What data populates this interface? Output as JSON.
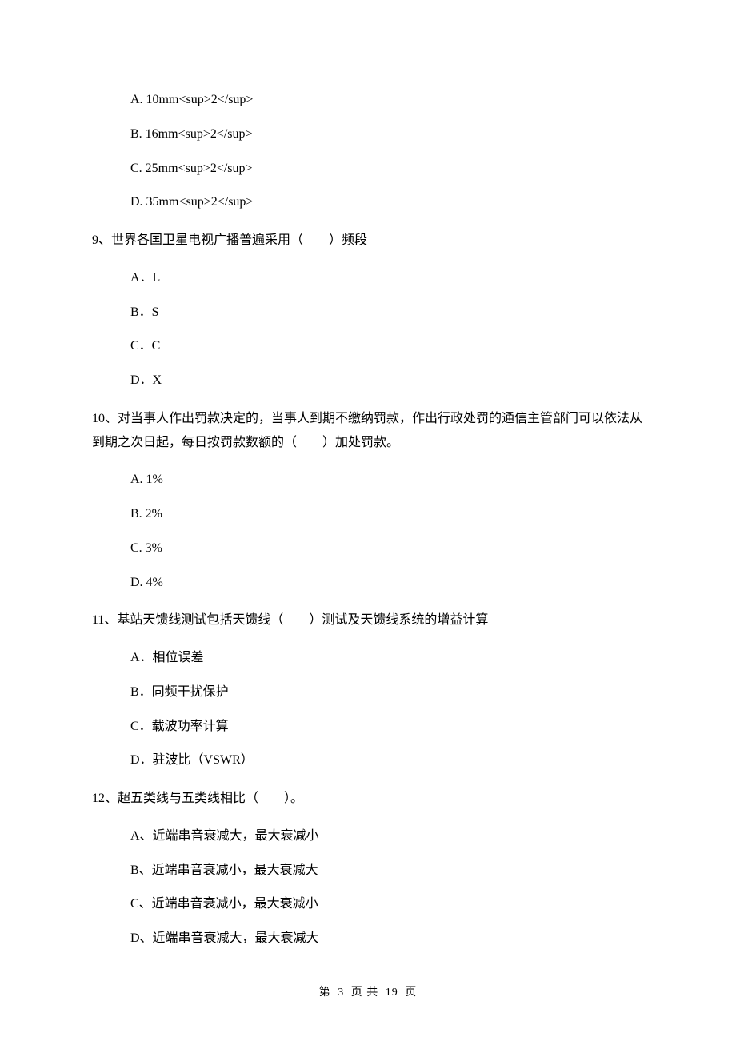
{
  "options_a": "A. 10mm<sup>2</sup>",
  "options_b": "B. 16mm<sup>2</sup>",
  "options_c": "C. 25mm<sup>2</sup>",
  "options_d": "D. 35mm<sup>2</sup>",
  "q9": "9、世界各国卫星电视广播普遍采用（　　）频段",
  "q9_a": "A．L",
  "q9_b": "B．S",
  "q9_c": "C．C",
  "q9_d": "D．X",
  "q10": "10、对当事人作出罚款决定的，当事人到期不缴纳罚款，作出行政处罚的通信主管部门可以依法从到期之次日起，每日按罚款数额的（　　）加处罚款。",
  "q10_a": "A. 1%",
  "q10_b": "B. 2%",
  "q10_c": "C. 3%",
  "q10_d": "D. 4%",
  "q11": "11、基站天馈线测试包括天馈线（　　）测试及天馈线系统的增益计算",
  "q11_a": "A．相位误差",
  "q11_b": "B．同频干扰保护",
  "q11_c": "C．载波功率计算",
  "q11_d": "D．驻波比（VSWR）",
  "q12": "12、超五类线与五类线相比（　　）。",
  "q12_a": "A、近端串音衰减大，最大衰减小",
  "q12_b": "B、近端串音衰减小，最大衰减大",
  "q12_c": "C、近端串音衰减小，最大衰减小",
  "q12_d": "D、近端串音衰减大，最大衰减大",
  "footer_prefix": "第",
  "footer_current": "3",
  "footer_mid": "页 共",
  "footer_total": "19",
  "footer_suffix": "页"
}
